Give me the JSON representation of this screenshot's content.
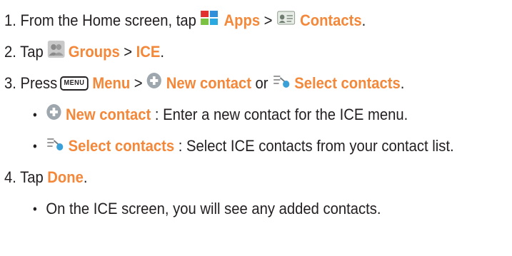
{
  "steps": {
    "s1": {
      "prefix": "1. From the Home screen, tap",
      "apps": "Apps",
      "sep": ">",
      "contacts": "Contacts",
      "end": "."
    },
    "s2": {
      "prefix": "2. Tap",
      "groups": "Groups",
      "sep": ">",
      "ice": "ICE",
      "end": "."
    },
    "s3": {
      "prefix": "3. Press",
      "menu_key": "MENU",
      "menu": "Menu",
      "sep": ">",
      "new_contact": "New contact",
      "or": "or",
      "select_contacts": "Select contacts",
      "end": "."
    },
    "bullet_new": {
      "label": "New contact",
      "desc": " : Enter a new contact for the ICE menu."
    },
    "bullet_select": {
      "label": "Select contacts",
      "desc": " : Select ICE contacts from your contact list."
    },
    "s4": {
      "prefix": "4. Tap",
      "done": "Done",
      "end": "."
    },
    "bullet_ice": {
      "text": "On the ICE screen, you will see any added contacts."
    }
  },
  "colors": {
    "accent": "#f4883a",
    "text": "#231f20"
  },
  "icons": [
    "apps-icon",
    "contacts-icon",
    "groups-icon",
    "add-icon",
    "select-contacts-icon"
  ]
}
